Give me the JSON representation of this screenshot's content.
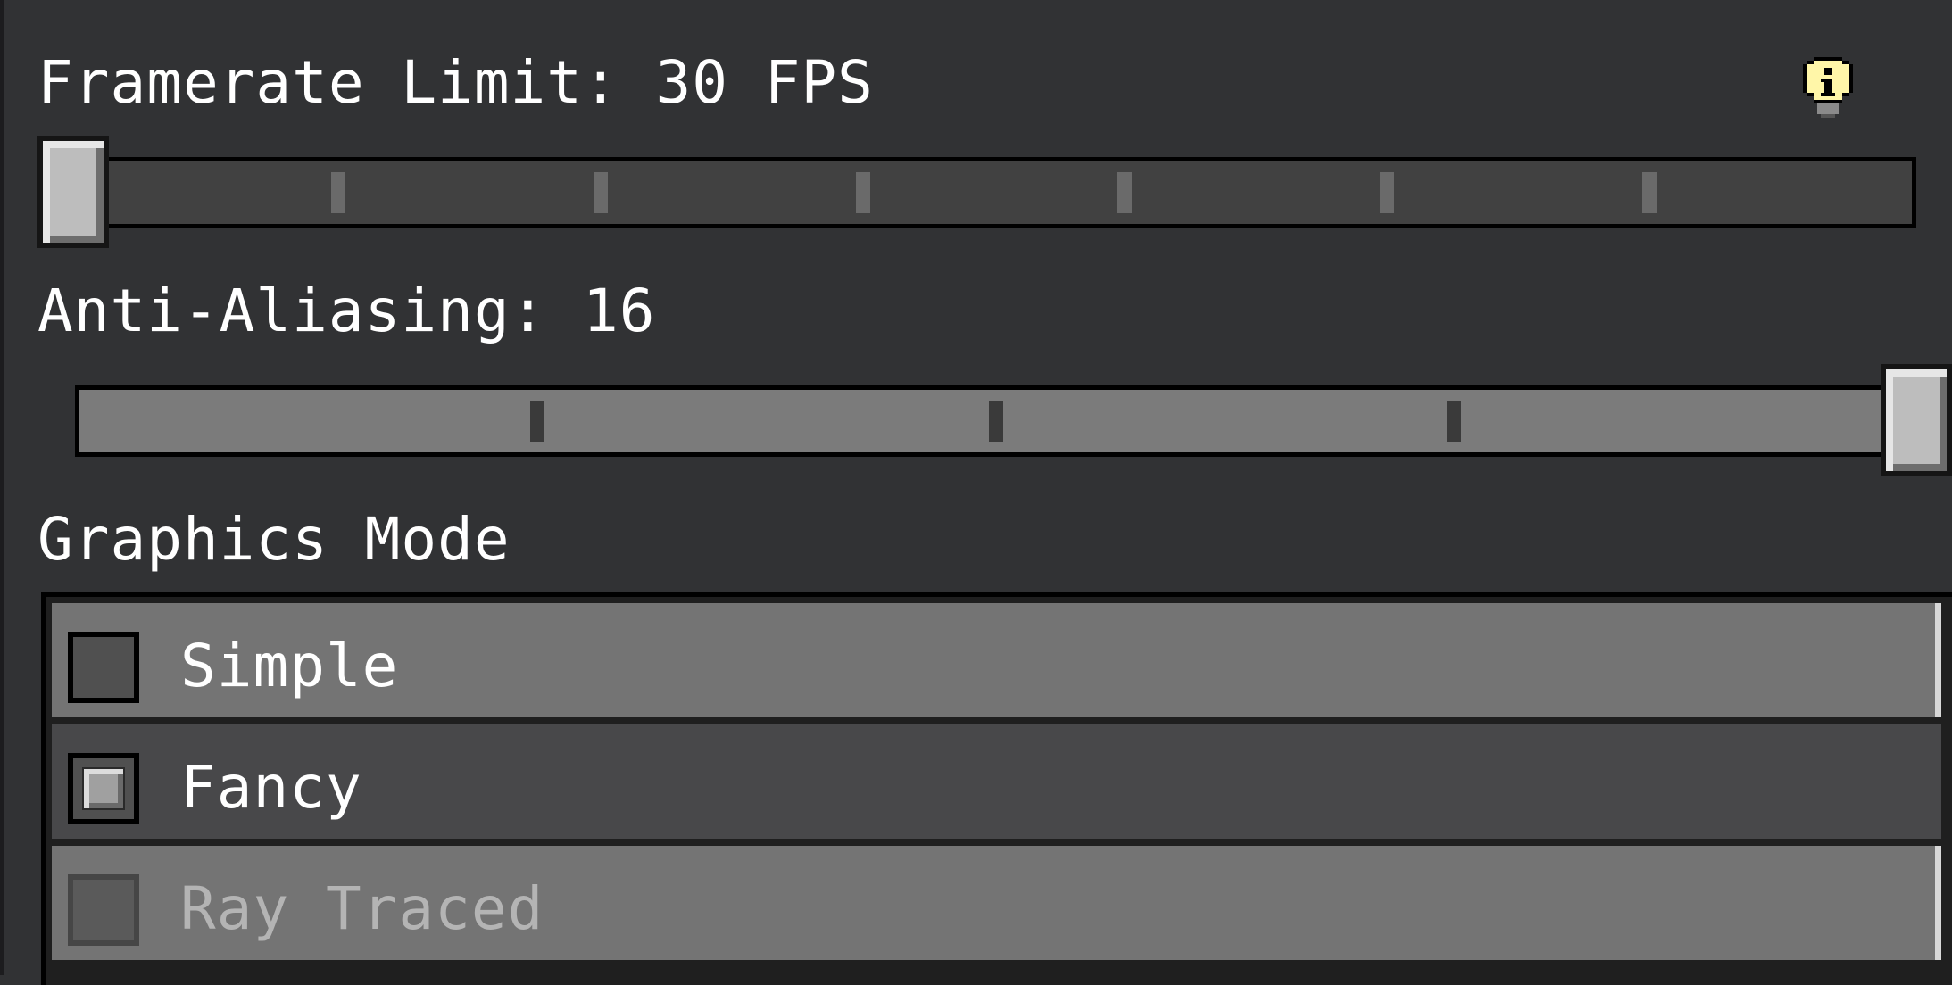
{
  "framerate": {
    "label": "Framerate Limit: 30 FPS",
    "value_fraction": 0.0,
    "tick_count": 6,
    "info_icon": "info-bulb-icon"
  },
  "antialiasing": {
    "label": "Anti-Aliasing: 16",
    "value_fraction": 1.0,
    "tick_count": 3
  },
  "graphics_mode": {
    "label": "Graphics Mode",
    "options": [
      {
        "label": "Simple",
        "checked": false,
        "disabled": false
      },
      {
        "label": "Fancy",
        "checked": true,
        "disabled": false
      },
      {
        "label": "Ray Traced",
        "checked": false,
        "disabled": true
      }
    ]
  },
  "colors": {
    "background": "#313234",
    "framerate_track": "#414141",
    "antialiasing_track": "#7b7b7b",
    "row_normal": "#747474",
    "row_selected": "#48484a",
    "text_disabled": "#b4b4b4",
    "info_bulb": "#fff6a8"
  }
}
